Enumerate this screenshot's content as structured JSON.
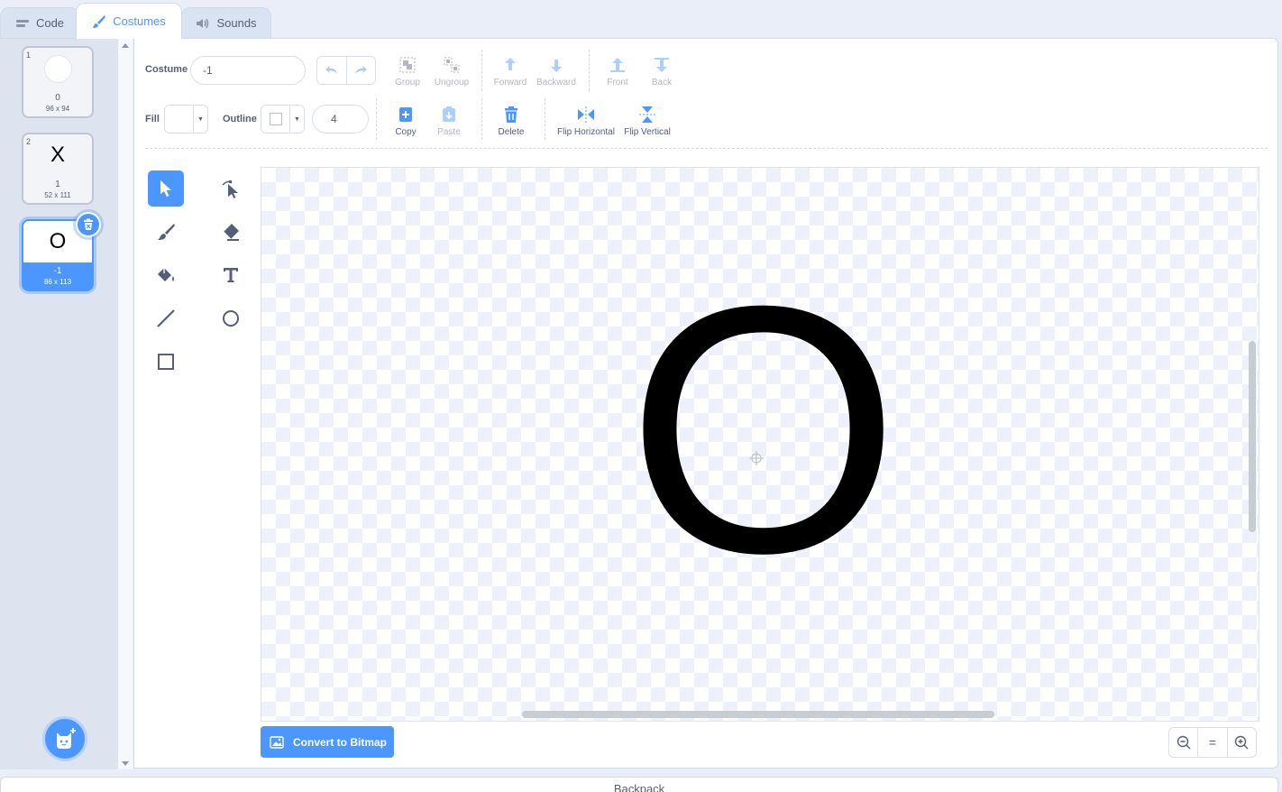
{
  "tabs": [
    {
      "label": "Code",
      "icon": "code-icon"
    },
    {
      "label": "Costumes",
      "icon": "paintbrush-icon"
    },
    {
      "label": "Sounds",
      "icon": "speaker-icon"
    }
  ],
  "costumes": [
    {
      "number": "1",
      "name": "0",
      "size": "96 x 94",
      "thumb": ""
    },
    {
      "number": "2",
      "name": "1",
      "size": "52 x 111",
      "thumb": "X"
    },
    {
      "number": "3",
      "name": "-1",
      "size": "86 x 113",
      "thumb": "O"
    }
  ],
  "toolbar": {
    "costume_label": "Costume",
    "costume_name": "-1",
    "fill_label": "Fill",
    "outline_label": "Outline",
    "outline_width": "4",
    "group": "Group",
    "ungroup": "Ungroup",
    "forward": "Forward",
    "backward": "Backward",
    "front": "Front",
    "back": "Back",
    "copy": "Copy",
    "paste": "Paste",
    "delete": "Delete",
    "flip_horizontal": "Flip Horizontal",
    "flip_vertical": "Flip Vertical"
  },
  "canvas": {
    "letter": "O"
  },
  "convert_button": "Convert to Bitmap",
  "zoom": {
    "zoom_out": "−",
    "reset": "=",
    "zoom_in": "+"
  },
  "backpack": "Backpack",
  "colors": {
    "accent": "#4c97ff",
    "text": "#575e75",
    "panel": "#e9eef8"
  }
}
